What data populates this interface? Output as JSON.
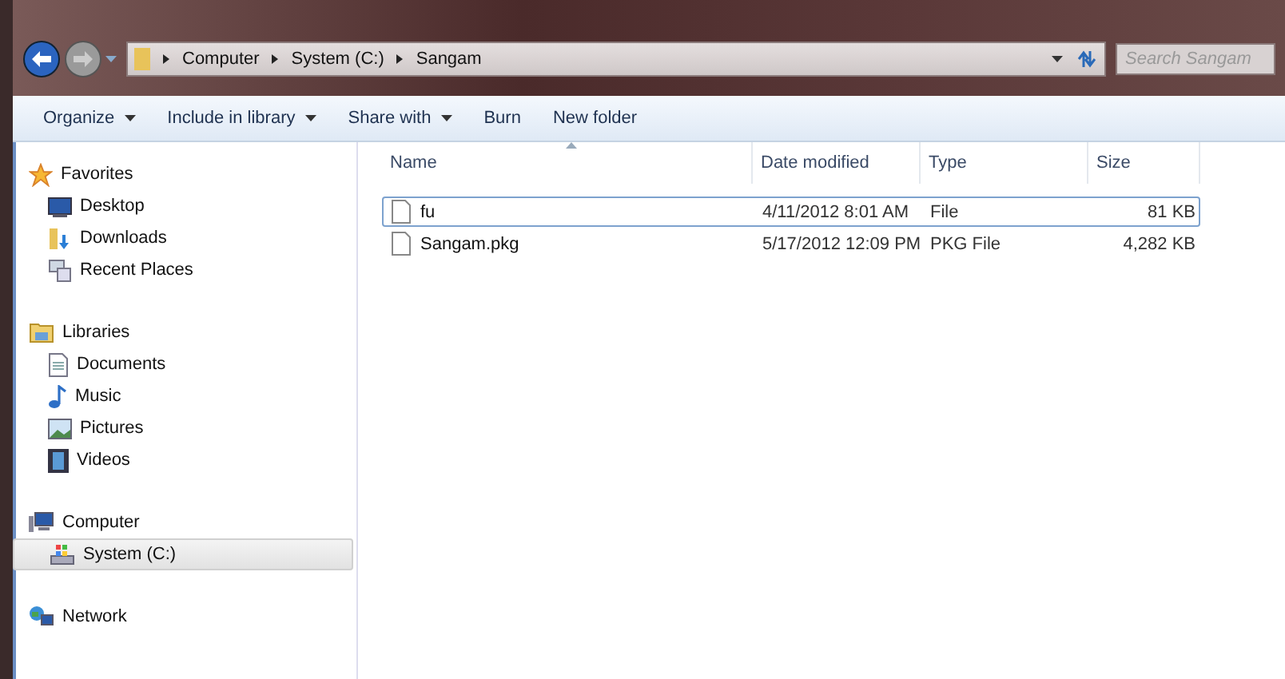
{
  "address_bar": {
    "path": [
      "Computer",
      "System (C:)",
      "Sangam"
    ]
  },
  "search": {
    "placeholder": "Search Sangam"
  },
  "toolbar": [
    {
      "label": "Organize",
      "dropdown": true
    },
    {
      "label": "Include in library",
      "dropdown": true
    },
    {
      "label": "Share with",
      "dropdown": true
    },
    {
      "label": "Burn",
      "dropdown": false
    },
    {
      "label": "New folder",
      "dropdown": false
    }
  ],
  "nav": [
    {
      "label": "Favorites",
      "selected": false,
      "children": [
        {
          "label": "Desktop",
          "selected": false
        },
        {
          "label": "Downloads",
          "selected": false
        },
        {
          "label": "Recent Places",
          "selected": false
        }
      ]
    },
    {
      "label": "Libraries",
      "selected": false,
      "children": [
        {
          "label": "Documents",
          "selected": false
        },
        {
          "label": "Music",
          "selected": false
        },
        {
          "label": "Pictures",
          "selected": false
        },
        {
          "label": "Videos",
          "selected": false
        }
      ]
    },
    {
      "label": "Computer",
      "selected": false,
      "children": [
        {
          "label": "System (C:)",
          "selected": true
        }
      ]
    },
    {
      "label": "Network",
      "selected": false
    }
  ],
  "table": {
    "columns": [
      "Name",
      "Date modified",
      "Type",
      "Size"
    ],
    "rows": [
      {
        "name": "fu",
        "date": "4/11/2012 8:01 AM",
        "type": "File",
        "size": "81 KB",
        "selected": true
      },
      {
        "name": "Sangam.pkg",
        "date": "5/17/2012 12:09 PM",
        "type": "PKG File",
        "size": "4,282 KB",
        "selected": false
      }
    ]
  }
}
